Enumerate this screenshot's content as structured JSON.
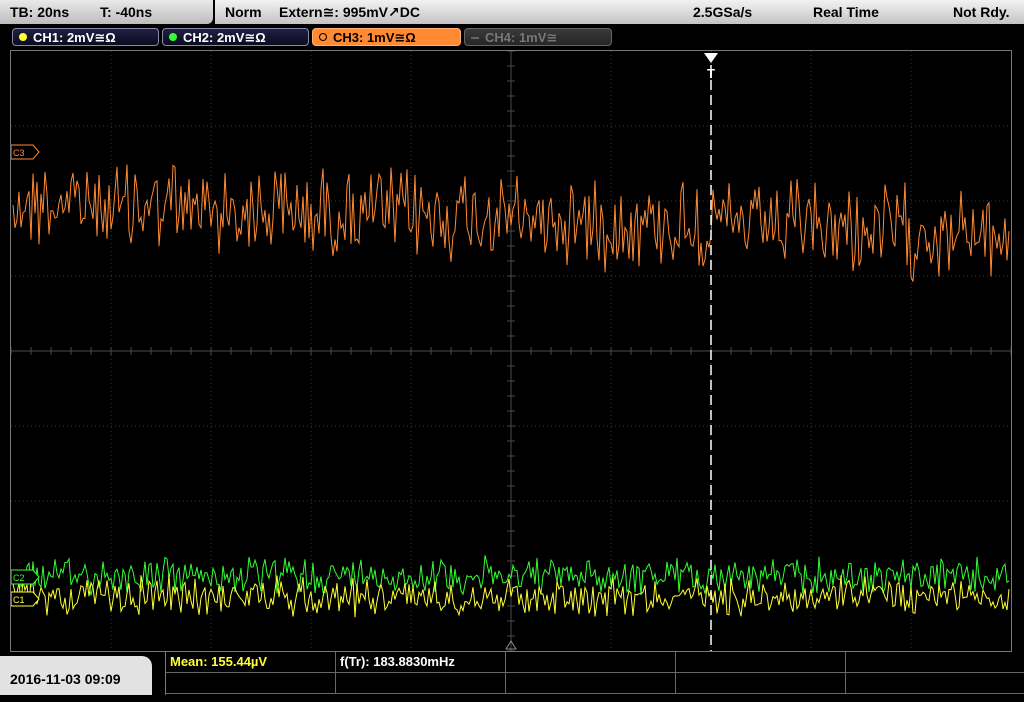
{
  "timebase": {
    "tb": "TB: 20ns",
    "t": "T: -40ns"
  },
  "status": {
    "mode": "Norm",
    "trigger": "Extern≅: 995mV↗DC",
    "sample_rate": "2.5GSa/s",
    "acq": "Real Time",
    "state": "Not Rdy."
  },
  "channels": [
    {
      "label": "CH1: 2mV≅Ω",
      "color": "#ffff33",
      "state": "on"
    },
    {
      "label": "CH2: 2mV≅Ω",
      "color": "#33ff33",
      "state": "on"
    },
    {
      "label": "CH3: 1mV≅Ω",
      "color": "#ff8a33",
      "state": "selected"
    },
    {
      "label": "CH4: 1mV≅",
      "color": "#888888",
      "state": "off"
    }
  ],
  "markers": {
    "ch3": "C3",
    "ch2": "C2",
    "ch1": "C1",
    "trigger": "T"
  },
  "footer": {
    "datetime": "2016-11-03 09:09",
    "mean": "Mean: 155.44µV",
    "freq": "f(Tr): 183.8830mHz"
  },
  "colors": {
    "ch1": "#ffff33",
    "ch2": "#33ff33",
    "ch3": "#ff8a33",
    "grid": "#555555"
  }
}
